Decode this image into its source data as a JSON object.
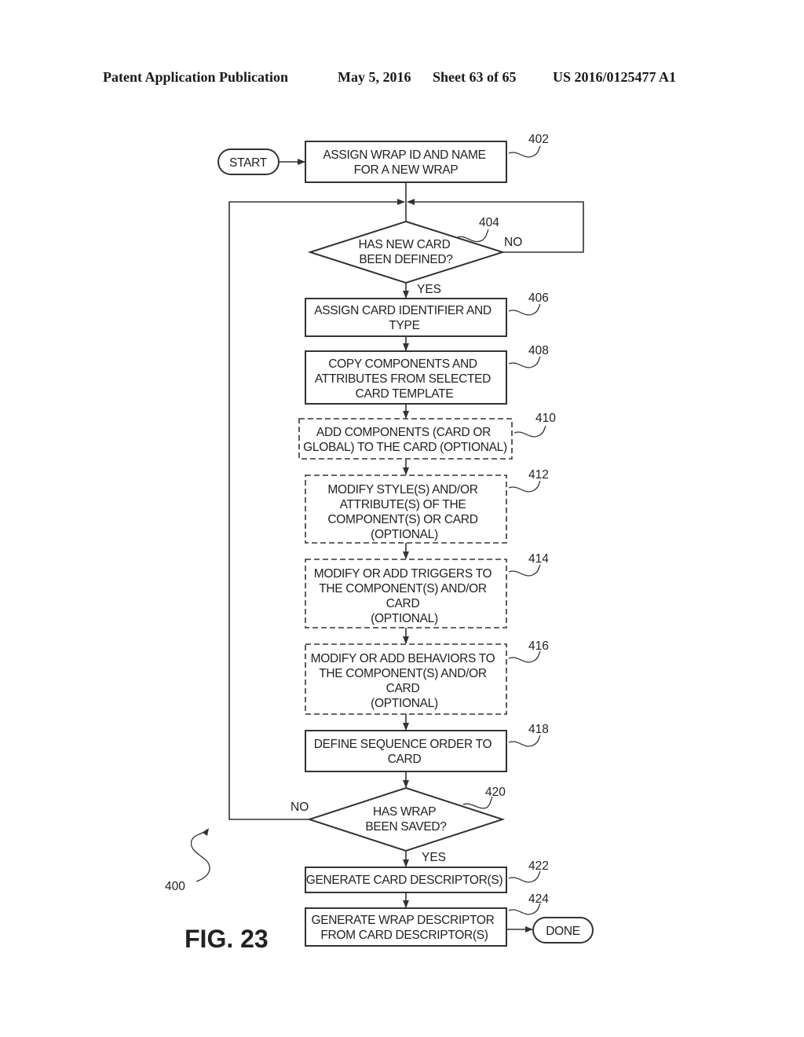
{
  "header": {
    "publication": "Patent Application Publication",
    "date": "May 5, 2016",
    "sheet": "Sheet 63 of 65",
    "number": "US 2016/0125477 A1"
  },
  "figure": {
    "label": "FIG. 23",
    "ref": "400",
    "start": "START",
    "done": "DONE",
    "steps": {
      "s402": {
        "ref": "402",
        "lines": [
          "ASSIGN WRAP ID AND NAME",
          "FOR A NEW WRAP"
        ]
      },
      "s404": {
        "ref": "404",
        "lines": [
          "HAS NEW CARD",
          "BEEN DEFINED?"
        ],
        "yes": "YES",
        "no": "NO"
      },
      "s406": {
        "ref": "406",
        "lines": [
          "ASSIGN CARD IDENTIFIER AND",
          "TYPE"
        ]
      },
      "s408": {
        "ref": "408",
        "lines": [
          "COPY COMPONENTS AND",
          "ATTRIBUTES FROM SELECTED",
          "CARD TEMPLATE"
        ]
      },
      "s410": {
        "ref": "410",
        "lines": [
          "ADD COMPONENTS (CARD OR",
          "GLOBAL) TO THE CARD (OPTIONAL)"
        ]
      },
      "s412": {
        "ref": "412",
        "lines": [
          "MODIFY STYLE(S) AND/OR",
          "ATTRIBUTE(S) OF THE",
          "COMPONENT(S) OR CARD",
          "(OPTIONAL)"
        ]
      },
      "s414": {
        "ref": "414",
        "lines": [
          "MODIFY OR ADD TRIGGERS TO",
          "THE COMPONENT(S) AND/OR",
          "CARD",
          "(OPTIONAL)"
        ]
      },
      "s416": {
        "ref": "416",
        "lines": [
          "MODIFY OR ADD BEHAVIORS TO",
          "THE COMPONENT(S) AND/OR",
          "CARD",
          "(OPTIONAL)"
        ]
      },
      "s418": {
        "ref": "418",
        "lines": [
          "DEFINE SEQUENCE ORDER TO",
          "CARD"
        ]
      },
      "s420": {
        "ref": "420",
        "lines": [
          "HAS WRAP",
          "BEEN SAVED?"
        ],
        "yes": "YES",
        "no": "NO"
      },
      "s422": {
        "ref": "422",
        "lines": [
          "GENERATE CARD DESCRIPTOR(S)"
        ]
      },
      "s424": {
        "ref": "424",
        "lines": [
          "GENERATE WRAP DESCRIPTOR",
          "FROM CARD DESCRIPTOR(S)"
        ]
      }
    }
  }
}
